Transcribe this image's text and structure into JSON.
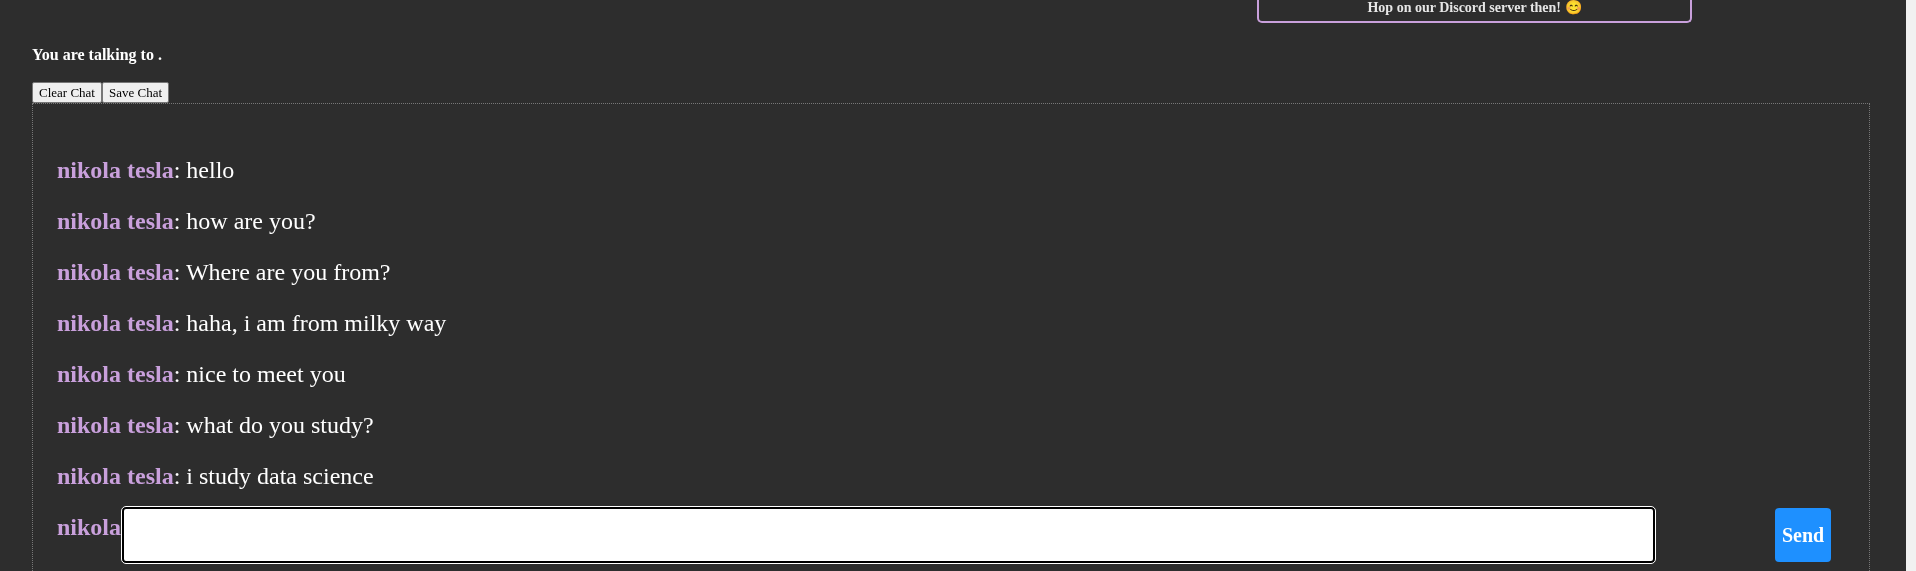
{
  "banner": {
    "text": "Hop on our Discord server then!",
    "emoji": "😊"
  },
  "heading": "You are talking to .",
  "buttons": [
    "Clear Chat",
    "Save Chat"
  ],
  "messages": [
    {
      "sender": "nikola tesla",
      "text": ": hello"
    },
    {
      "sender": "nikola tesla",
      "text": ": how are you?"
    },
    {
      "sender": "nikola tesla",
      "text": ": Where are you from?"
    },
    {
      "sender": "nikola tesla",
      "text": ": haha, i am from milky way"
    },
    {
      "sender": "nikola tesla",
      "text": ": nice to meet you"
    },
    {
      "sender": "nikola tesla",
      "text": ": what do you study?"
    },
    {
      "sender": "nikola tesla",
      "text": ": i study data science"
    },
    {
      "sender": "nikola"
    }
  ],
  "composer": {
    "send": "Send"
  }
}
